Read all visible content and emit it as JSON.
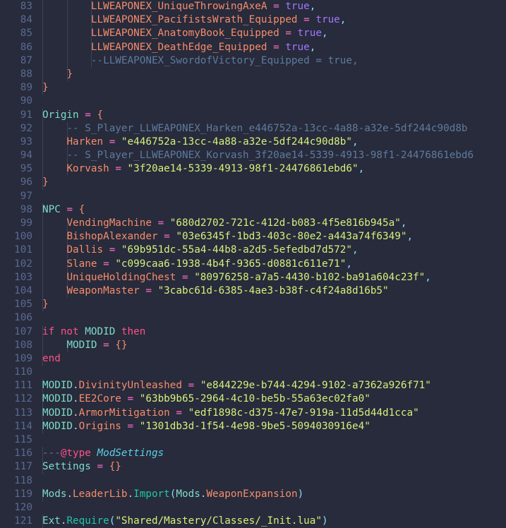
{
  "editor": {
    "language": "lua",
    "theme_background": "#272b3b",
    "gutter_color": "#5c6a93",
    "first_line": 83,
    "last_line": 121
  },
  "colors": {
    "background": "#272b3b",
    "line_number": "#5c6a93",
    "identifier": "#f78c6c",
    "operator": "#ff6ec7",
    "keyword": "#ff5189",
    "boolean": "#a277ff",
    "variable": "#7fdbca",
    "comment": "#5f7a9e",
    "string": "#d5f07c",
    "function": "#21c7a8",
    "type": "#5ccfe6",
    "punctuation": "#89ddff",
    "default_text": "#c7cbd9",
    "indent_guide": "#3d4257"
  },
  "lines": [
    {
      "num": 83,
      "indent_guides": 3,
      "tokens": [
        {
          "t": "        ",
          "c": "t-default"
        },
        {
          "t": "LLWEAPONEX_UniqueThrowingAxeA",
          "c": "t-ident"
        },
        {
          "t": " ",
          "c": "t-default"
        },
        {
          "t": "=",
          "c": "t-op"
        },
        {
          "t": " ",
          "c": "t-default"
        },
        {
          "t": "true",
          "c": "t-bool"
        },
        {
          "t": ",",
          "c": "t-punc"
        }
      ]
    },
    {
      "num": 84,
      "indent_guides": 3,
      "tokens": [
        {
          "t": "        ",
          "c": "t-default"
        },
        {
          "t": "LLWEAPONEX_PacifistsWrath_Equipped",
          "c": "t-ident"
        },
        {
          "t": " ",
          "c": "t-default"
        },
        {
          "t": "=",
          "c": "t-op"
        },
        {
          "t": " ",
          "c": "t-default"
        },
        {
          "t": "true",
          "c": "t-bool"
        },
        {
          "t": ",",
          "c": "t-punc"
        }
      ]
    },
    {
      "num": 85,
      "indent_guides": 3,
      "tokens": [
        {
          "t": "        ",
          "c": "t-default"
        },
        {
          "t": "LLWEAPONEX_AnatomyBook_Equipped",
          "c": "t-ident"
        },
        {
          "t": " ",
          "c": "t-default"
        },
        {
          "t": "=",
          "c": "t-op"
        },
        {
          "t": " ",
          "c": "t-default"
        },
        {
          "t": "true",
          "c": "t-bool"
        },
        {
          "t": ",",
          "c": "t-punc"
        }
      ]
    },
    {
      "num": 86,
      "indent_guides": 3,
      "tokens": [
        {
          "t": "        ",
          "c": "t-default"
        },
        {
          "t": "LLWEAPONEX_DeathEdge_Equipped",
          "c": "t-ident"
        },
        {
          "t": " ",
          "c": "t-default"
        },
        {
          "t": "=",
          "c": "t-op"
        },
        {
          "t": " ",
          "c": "t-default"
        },
        {
          "t": "true",
          "c": "t-bool"
        },
        {
          "t": ",",
          "c": "t-punc"
        }
      ]
    },
    {
      "num": 87,
      "indent_guides": 3,
      "tokens": [
        {
          "t": "        ",
          "c": "t-default"
        },
        {
          "t": "--LLWEAPONEX_SwordofVictory_Equipped = true,",
          "c": "t-comment"
        }
      ]
    },
    {
      "num": 88,
      "indent_guides": 2,
      "tokens": [
        {
          "t": "    ",
          "c": "t-default"
        },
        {
          "t": "}",
          "c": "t-brace"
        }
      ]
    },
    {
      "num": 89,
      "indent_guides": 1,
      "tokens": [
        {
          "t": "}",
          "c": "t-brace"
        }
      ]
    },
    {
      "num": 90,
      "indent_guides": 0,
      "tokens": []
    },
    {
      "num": 91,
      "indent_guides": 1,
      "tokens": [
        {
          "t": "Origin",
          "c": "t-var"
        },
        {
          "t": " ",
          "c": "t-default"
        },
        {
          "t": "=",
          "c": "t-op"
        },
        {
          "t": " ",
          "c": "t-default"
        },
        {
          "t": "{",
          "c": "t-brace"
        }
      ]
    },
    {
      "num": 92,
      "indent_guides": 2,
      "tokens": [
        {
          "t": "    ",
          "c": "t-default"
        },
        {
          "t": "-- S_Player_LLWEAPONEX_Harken_e446752a-13cc-4a88-a32e-5df244c90d8b",
          "c": "t-comment"
        }
      ]
    },
    {
      "num": 93,
      "indent_guides": 2,
      "tokens": [
        {
          "t": "    ",
          "c": "t-default"
        },
        {
          "t": "Harken",
          "c": "t-ident"
        },
        {
          "t": " ",
          "c": "t-default"
        },
        {
          "t": "=",
          "c": "t-op"
        },
        {
          "t": " ",
          "c": "t-default"
        },
        {
          "t": "\"e446752a-13cc-4a88-a32e-5df244c90d8b\"",
          "c": "t-string"
        },
        {
          "t": ",",
          "c": "t-punc"
        }
      ]
    },
    {
      "num": 94,
      "indent_guides": 2,
      "tokens": [
        {
          "t": "    ",
          "c": "t-default"
        },
        {
          "t": "-- S_Player_LLWEAPONEX_Korvash_3f20ae14-5339-4913-98f1-24476861ebd6",
          "c": "t-comment"
        }
      ]
    },
    {
      "num": 95,
      "indent_guides": 2,
      "tokens": [
        {
          "t": "    ",
          "c": "t-default"
        },
        {
          "t": "Korvash",
          "c": "t-ident"
        },
        {
          "t": " ",
          "c": "t-default"
        },
        {
          "t": "=",
          "c": "t-op"
        },
        {
          "t": " ",
          "c": "t-default"
        },
        {
          "t": "\"3f20ae14-5339-4913-98f1-24476861ebd6\"",
          "c": "t-string"
        },
        {
          "t": ",",
          "c": "t-punc"
        }
      ]
    },
    {
      "num": 96,
      "indent_guides": 1,
      "tokens": [
        {
          "t": "}",
          "c": "t-brace"
        }
      ]
    },
    {
      "num": 97,
      "indent_guides": 0,
      "tokens": []
    },
    {
      "num": 98,
      "indent_guides": 1,
      "tokens": [
        {
          "t": "NPC",
          "c": "t-var"
        },
        {
          "t": " ",
          "c": "t-default"
        },
        {
          "t": "=",
          "c": "t-op"
        },
        {
          "t": " ",
          "c": "t-default"
        },
        {
          "t": "{",
          "c": "t-brace"
        }
      ]
    },
    {
      "num": 99,
      "indent_guides": 2,
      "tokens": [
        {
          "t": "    ",
          "c": "t-default"
        },
        {
          "t": "VendingMachine",
          "c": "t-ident"
        },
        {
          "t": " ",
          "c": "t-default"
        },
        {
          "t": "=",
          "c": "t-op"
        },
        {
          "t": " ",
          "c": "t-default"
        },
        {
          "t": "\"680d2702-721c-412d-b083-4f5e816b945a\"",
          "c": "t-string"
        },
        {
          "t": ",",
          "c": "t-punc"
        }
      ]
    },
    {
      "num": 100,
      "indent_guides": 2,
      "tokens": [
        {
          "t": "    ",
          "c": "t-default"
        },
        {
          "t": "BishopAlexander",
          "c": "t-ident"
        },
        {
          "t": " ",
          "c": "t-default"
        },
        {
          "t": "=",
          "c": "t-op"
        },
        {
          "t": " ",
          "c": "t-default"
        },
        {
          "t": "\"03e6345f-1bd3-403c-80e2-a443a74f6349\"",
          "c": "t-string"
        },
        {
          "t": ",",
          "c": "t-punc"
        }
      ]
    },
    {
      "num": 101,
      "indent_guides": 2,
      "tokens": [
        {
          "t": "    ",
          "c": "t-default"
        },
        {
          "t": "Dallis",
          "c": "t-ident"
        },
        {
          "t": " ",
          "c": "t-default"
        },
        {
          "t": "=",
          "c": "t-op"
        },
        {
          "t": " ",
          "c": "t-default"
        },
        {
          "t": "\"69b951dc-55a4-44b8-a2d5-5efedbd7d572\"",
          "c": "t-string"
        },
        {
          "t": ",",
          "c": "t-punc"
        }
      ]
    },
    {
      "num": 102,
      "indent_guides": 2,
      "tokens": [
        {
          "t": "    ",
          "c": "t-default"
        },
        {
          "t": "Slane",
          "c": "t-ident"
        },
        {
          "t": " ",
          "c": "t-default"
        },
        {
          "t": "=",
          "c": "t-op"
        },
        {
          "t": " ",
          "c": "t-default"
        },
        {
          "t": "\"c099caa6-1938-4b4f-9365-d0881c611e71\"",
          "c": "t-string"
        },
        {
          "t": ",",
          "c": "t-punc"
        }
      ]
    },
    {
      "num": 103,
      "indent_guides": 2,
      "tokens": [
        {
          "t": "    ",
          "c": "t-default"
        },
        {
          "t": "UniqueHoldingChest",
          "c": "t-ident"
        },
        {
          "t": " ",
          "c": "t-default"
        },
        {
          "t": "=",
          "c": "t-op"
        },
        {
          "t": " ",
          "c": "t-default"
        },
        {
          "t": "\"80976258-a7a5-4430-b102-ba91a604c23f\"",
          "c": "t-string"
        },
        {
          "t": ",",
          "c": "t-punc"
        }
      ]
    },
    {
      "num": 104,
      "indent_guides": 2,
      "tokens": [
        {
          "t": "    ",
          "c": "t-default"
        },
        {
          "t": "WeaponMaster",
          "c": "t-ident"
        },
        {
          "t": " ",
          "c": "t-default"
        },
        {
          "t": "=",
          "c": "t-op"
        },
        {
          "t": " ",
          "c": "t-default"
        },
        {
          "t": "\"3cabc61d-6385-4ae3-b38f-c4f24a8d16b5\"",
          "c": "t-string"
        }
      ]
    },
    {
      "num": 105,
      "indent_guides": 1,
      "tokens": [
        {
          "t": "}",
          "c": "t-brace"
        }
      ]
    },
    {
      "num": 106,
      "indent_guides": 0,
      "tokens": []
    },
    {
      "num": 107,
      "indent_guides": 1,
      "tokens": [
        {
          "t": "if",
          "c": "t-kw"
        },
        {
          "t": " ",
          "c": "t-default"
        },
        {
          "t": "not",
          "c": "t-kw"
        },
        {
          "t": " ",
          "c": "t-default"
        },
        {
          "t": "MODID",
          "c": "t-var"
        },
        {
          "t": " ",
          "c": "t-default"
        },
        {
          "t": "then",
          "c": "t-kw"
        }
      ]
    },
    {
      "num": 108,
      "indent_guides": 2,
      "tokens": [
        {
          "t": "    ",
          "c": "t-default"
        },
        {
          "t": "MODID",
          "c": "t-var"
        },
        {
          "t": " ",
          "c": "t-default"
        },
        {
          "t": "=",
          "c": "t-op"
        },
        {
          "t": " ",
          "c": "t-default"
        },
        {
          "t": "{}",
          "c": "t-brace"
        }
      ]
    },
    {
      "num": 109,
      "indent_guides": 1,
      "tokens": [
        {
          "t": "end",
          "c": "t-kw"
        }
      ]
    },
    {
      "num": 110,
      "indent_guides": 0,
      "tokens": []
    },
    {
      "num": 111,
      "indent_guides": 1,
      "tokens": [
        {
          "t": "MODID",
          "c": "t-var"
        },
        {
          "t": ".",
          "c": "t-dot"
        },
        {
          "t": "DivinityUnleashed",
          "c": "t-prop"
        },
        {
          "t": " ",
          "c": "t-default"
        },
        {
          "t": "=",
          "c": "t-op"
        },
        {
          "t": " ",
          "c": "t-default"
        },
        {
          "t": "\"e844229e-b744-4294-9102-a7362a926f71\"",
          "c": "t-string"
        }
      ]
    },
    {
      "num": 112,
      "indent_guides": 1,
      "tokens": [
        {
          "t": "MODID",
          "c": "t-var"
        },
        {
          "t": ".",
          "c": "t-dot"
        },
        {
          "t": "EE2Core",
          "c": "t-prop"
        },
        {
          "t": " ",
          "c": "t-default"
        },
        {
          "t": "=",
          "c": "t-op"
        },
        {
          "t": " ",
          "c": "t-default"
        },
        {
          "t": "\"63bb9b65-2964-4c10-be5b-55a63ec02fa0\"",
          "c": "t-string"
        }
      ]
    },
    {
      "num": 113,
      "indent_guides": 1,
      "tokens": [
        {
          "t": "MODID",
          "c": "t-var"
        },
        {
          "t": ".",
          "c": "t-dot"
        },
        {
          "t": "ArmorMitigation",
          "c": "t-prop"
        },
        {
          "t": " ",
          "c": "t-default"
        },
        {
          "t": "=",
          "c": "t-op"
        },
        {
          "t": " ",
          "c": "t-default"
        },
        {
          "t": "\"edf1898c-d375-47e7-919a-11d5d44d1cca\"",
          "c": "t-string"
        }
      ]
    },
    {
      "num": 114,
      "indent_guides": 1,
      "tokens": [
        {
          "t": "MODID",
          "c": "t-var"
        },
        {
          "t": ".",
          "c": "t-dot"
        },
        {
          "t": "Origins",
          "c": "t-prop"
        },
        {
          "t": " ",
          "c": "t-default"
        },
        {
          "t": "=",
          "c": "t-op"
        },
        {
          "t": " ",
          "c": "t-default"
        },
        {
          "t": "\"1301db3d-1f54-4e98-9be5-5094030916e4\"",
          "c": "t-string"
        }
      ]
    },
    {
      "num": 115,
      "indent_guides": 0,
      "tokens": []
    },
    {
      "num": 116,
      "indent_guides": 1,
      "tokens": [
        {
          "t": "---",
          "c": "t-comment"
        },
        {
          "t": "@type",
          "c": "t-at"
        },
        {
          "t": " ",
          "c": "t-default"
        },
        {
          "t": "ModSettings",
          "c": "t-type"
        }
      ]
    },
    {
      "num": 117,
      "indent_guides": 1,
      "tokens": [
        {
          "t": "Settings",
          "c": "t-var"
        },
        {
          "t": " ",
          "c": "t-default"
        },
        {
          "t": "=",
          "c": "t-op"
        },
        {
          "t": " ",
          "c": "t-default"
        },
        {
          "t": "{}",
          "c": "t-brace"
        }
      ]
    },
    {
      "num": 118,
      "indent_guides": 0,
      "tokens": []
    },
    {
      "num": 119,
      "indent_guides": 1,
      "tokens": [
        {
          "t": "Mods",
          "c": "t-var"
        },
        {
          "t": ".",
          "c": "t-dot"
        },
        {
          "t": "LeaderLib",
          "c": "t-prop"
        },
        {
          "t": ".",
          "c": "t-dot"
        },
        {
          "t": "Import",
          "c": "t-func"
        },
        {
          "t": "(",
          "c": "t-punc"
        },
        {
          "t": "Mods",
          "c": "t-var"
        },
        {
          "t": ".",
          "c": "t-dot"
        },
        {
          "t": "WeaponExpansion",
          "c": "t-prop"
        },
        {
          "t": ")",
          "c": "t-punc"
        }
      ]
    },
    {
      "num": 120,
      "indent_guides": 0,
      "tokens": []
    },
    {
      "num": 121,
      "indent_guides": 1,
      "tokens": [
        {
          "t": "Ext",
          "c": "t-var"
        },
        {
          "t": ".",
          "c": "t-dot"
        },
        {
          "t": "Require",
          "c": "t-func"
        },
        {
          "t": "(",
          "c": "t-punc"
        },
        {
          "t": "\"Shared/Mastery/Classes/_Init.lua\"",
          "c": "t-string"
        },
        {
          "t": ")",
          "c": "t-punc"
        }
      ]
    }
  ]
}
